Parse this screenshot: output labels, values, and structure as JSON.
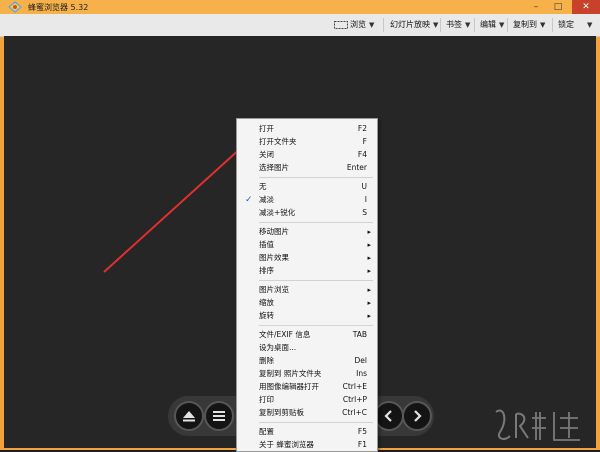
{
  "window": {
    "title": "蜂蜜浏览器 5.32",
    "min_symbol": "–",
    "max_symbol": "□",
    "close_symbol": "✕"
  },
  "toolbar": {
    "items": [
      {
        "label": "浏览",
        "icon": "browse-screen-icon"
      },
      {
        "label": "幻灯片放映"
      },
      {
        "label": "书签"
      },
      {
        "label": "编辑"
      },
      {
        "label": "复制到"
      },
      {
        "label": "锁定"
      }
    ]
  },
  "menu": {
    "items": [
      {
        "label": "打开",
        "shortcut": "F2"
      },
      {
        "label": "打开文件夹",
        "shortcut": "F"
      },
      {
        "label": "关闭",
        "shortcut": "F4"
      },
      {
        "label": "选择图片",
        "shortcut": "Enter"
      },
      {
        "label": "无",
        "shortcut": "U"
      },
      {
        "label": "减淡",
        "shortcut": "I",
        "checked": true
      },
      {
        "label": "减淡+锐化",
        "shortcut": "S"
      },
      {
        "label": "移动图片",
        "submenu": true
      },
      {
        "label": "插值",
        "submenu": true
      },
      {
        "label": "图片效果",
        "submenu": true
      },
      {
        "label": "排序",
        "submenu": true
      },
      {
        "label": "图片浏览",
        "submenu": true
      },
      {
        "label": "缩放",
        "submenu": true
      },
      {
        "label": "旋转",
        "submenu": true
      },
      {
        "label": "文件/EXIF 信息",
        "shortcut": "TAB"
      },
      {
        "label": "设为桌面...",
        "shortcut": ""
      },
      {
        "label": "删除",
        "shortcut": "Del"
      },
      {
        "label": "复制到 照片文件夹",
        "shortcut": "Ins"
      },
      {
        "label": "用图像编辑器打开",
        "shortcut": "Ctrl+E"
      },
      {
        "label": "打印",
        "shortcut": "Ctrl+P"
      },
      {
        "label": "复制到剪贴板",
        "shortcut": "Ctrl+C"
      },
      {
        "label": "配置",
        "shortcut": "F5"
      },
      {
        "label": "关于 蜂蜜浏览器",
        "shortcut": "F1"
      }
    ],
    "check_mark": "✓",
    "submenu_arrow": "▸"
  },
  "annotation": {
    "arrow_color": "#e03030"
  },
  "watermark": {
    "text": "𝓛𝓡巴资源"
  },
  "colors": {
    "border_orange": "#f3a13a",
    "canvas": "#262626"
  }
}
